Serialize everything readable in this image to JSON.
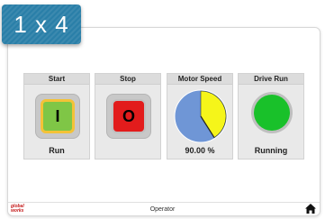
{
  "badge": {
    "text": "1 x 4"
  },
  "panels": {
    "start": {
      "title": "Start",
      "button_label": "I",
      "status": "Run"
    },
    "stop": {
      "title": "Stop",
      "button_label": "O"
    },
    "motor_speed": {
      "title": "Motor Speed",
      "value_text": "90.00 %",
      "fraction": 0.9
    },
    "drive_run": {
      "title": "Drive Run",
      "status": "Running"
    }
  },
  "footer": {
    "logo_text": "global works",
    "label": "Operator",
    "home_icon": "home-icon"
  },
  "colors": {
    "start_fill": "#7fc646",
    "start_border": "#f4c237",
    "stop_fill": "#e21c1c",
    "gauge_bg": "#6f96d6",
    "gauge_fill": "#f5f51a",
    "lamp_on": "#19c12a",
    "badge": "#2a7fa8"
  }
}
